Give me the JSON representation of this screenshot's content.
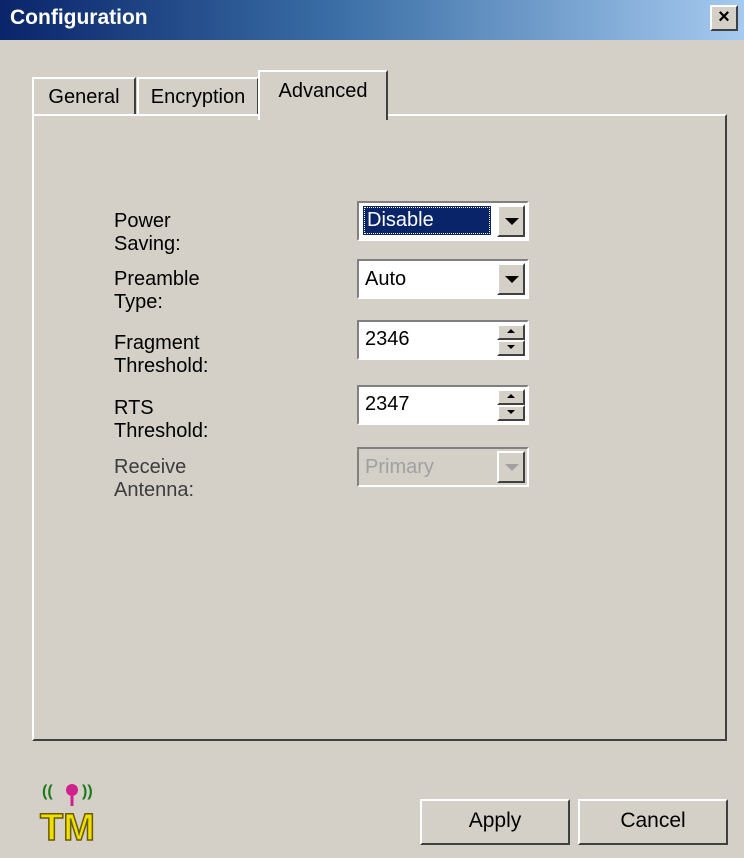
{
  "window": {
    "title": "Configuration",
    "close_label": "×"
  },
  "tabs": [
    "General",
    "Encryption",
    "Advanced"
  ],
  "active_tab": "Advanced",
  "fields": {
    "power_saving": {
      "label": "Power Saving:",
      "value": "Disable"
    },
    "preamble_type": {
      "label": "Preamble Type:",
      "value": "Auto"
    },
    "fragment_threshold": {
      "label": "Fragment Threshold:",
      "value": "2346"
    },
    "rts_threshold": {
      "label": "RTS Threshold:",
      "value": "2347"
    },
    "receive_antenna": {
      "label": "Receive Antenna:",
      "value": "Primary",
      "disabled": true
    }
  },
  "buttons": {
    "apply": "Apply",
    "cancel": "Cancel"
  },
  "logo": {
    "icon": "wireless-tm-logo-icon",
    "text": "TM"
  },
  "colors": {
    "title_start": "#0a246a",
    "title_end": "#a6caf0",
    "selection": "#0a246a",
    "face": "#d4d0c8"
  }
}
